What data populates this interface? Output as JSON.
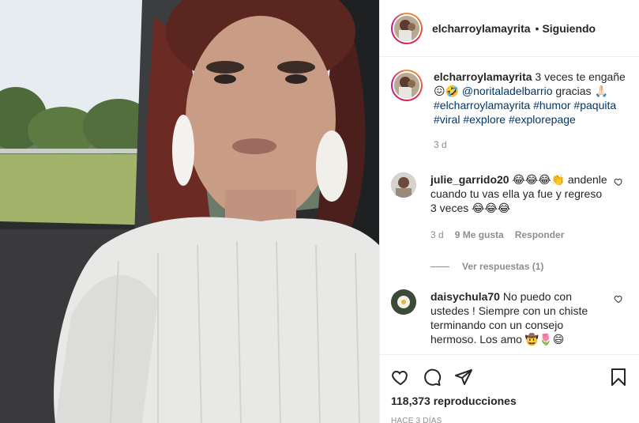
{
  "post": {
    "author": "elcharroylamayrita",
    "follow_status": "Siguiendo",
    "dot": "•",
    "caption": {
      "username": "elcharroylamayrita",
      "text_1": "3 veces te engañe",
      "emoji_1": "😖🤣",
      "mention": "@noritaladelbarrio",
      "text_2": "gracias",
      "emoji_2": "🙏🏻",
      "hashtags": [
        "#elcharroylamayrita",
        "#humor",
        "#paquita",
        "#viral",
        "#explore",
        "#explorepage"
      ],
      "time": "3 d"
    }
  },
  "comments": [
    {
      "username": "julie_garrido20",
      "text": "😂😂😂👏 andenle cuando tu vas ella ya fue y regreso 3 veces 😂😂😂",
      "time": "3 d",
      "likes": "9 Me gusta",
      "reply_label": "Responder",
      "view_replies": "Ver respuestas (1)"
    },
    {
      "username": "daisychula70",
      "text": "No puedo con ustedes ! Siempre con un chiste terminando con un consejo hermoso. Los amo 🤠🌷😄"
    }
  ],
  "footer": {
    "views": "118,373 reproducciones",
    "posted_ago": "HACE 3 DÍAS"
  },
  "icons": {
    "like": "heart-icon",
    "comment": "comment-icon",
    "share": "share-icon",
    "save": "bookmark-icon"
  },
  "colors": {
    "text": "#262626",
    "muted": "#8e8e8e",
    "link": "#00376b",
    "border": "#efefef"
  }
}
